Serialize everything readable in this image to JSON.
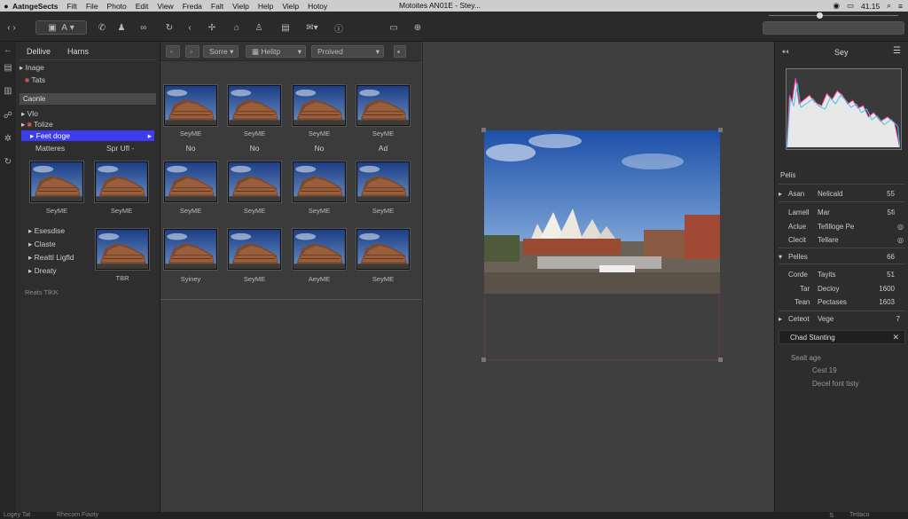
{
  "menubar": {
    "app": "AatngeSects",
    "items": [
      "Filt",
      "File",
      "Photo",
      "Edit",
      "View",
      "Freda",
      "Falt",
      "Vielp",
      "Help",
      "Vielp",
      "Hotoy"
    ],
    "title": "Motoites AN01E - Stey...",
    "time": "41.15"
  },
  "toolbar": {
    "zoom_label": "A"
  },
  "left_panel": {
    "tabs": [
      "Dellive",
      "Harns"
    ],
    "items_top": [
      "Inage",
      "Tats"
    ],
    "header": "Caonle",
    "items_mid": [
      "Vlo",
      "Tolize"
    ],
    "selected": "Feet doge",
    "row_labels": [
      "Matteres",
      "Spr Ufl -"
    ],
    "items_bottom": [
      "Esesdise",
      "Claste",
      "Reattl Ligfld",
      "Dreaty"
    ],
    "bottom_thumb_label": "TBR",
    "footer": "Reats TlKK"
  },
  "grid_panel": {
    "buttons": [
      "Sorre",
      "Helitp",
      "Proived"
    ],
    "row1_labels": [
      "SeyME",
      "SeyME",
      "SeyME",
      "SeyME"
    ],
    "row1_sub": [
      "No",
      "No",
      "No",
      "Ad"
    ],
    "row2_labels": [
      "SeyME",
      "SeyME",
      "SeyME",
      "SeyME"
    ],
    "row3_labels": [
      "Syiney",
      "SeyME",
      "AeyME",
      "SeyME"
    ],
    "left_thumbs_labels": [
      "SeyME",
      "SeyME"
    ]
  },
  "right_panel": {
    "title": "Sey",
    "section": "Pelis",
    "rows": [
      {
        "arrow": "▸",
        "label": "Asan",
        "value": "Nelicald",
        "num": "55"
      },
      {
        "arrow": "",
        "label": "Lamell",
        "value": "Mar",
        "num": "5fi"
      },
      {
        "arrow": "",
        "label": "Aclue",
        "value": "Tefilloge Pe",
        "num": ""
      },
      {
        "arrow": "",
        "label": "Clecit",
        "value": "Tellare",
        "num": ""
      },
      {
        "arrow": "▾",
        "label": "Pelles",
        "value": "",
        "num": "66"
      },
      {
        "arrow": "",
        "label": "Corde",
        "value": "Tayits",
        "num": "51"
      },
      {
        "arrow": "",
        "label": "Tar",
        "value": "Decloy",
        "num": "1600"
      },
      {
        "arrow": "",
        "label": "Tean",
        "value": "Pectases",
        "num": "1603"
      },
      {
        "arrow": "▸",
        "label": "Ceteot",
        "value": "Vege",
        "num": "7"
      }
    ],
    "chip": "Chad Stanting",
    "notes": [
      "Sealt age",
      "Cest 19",
      "Decel font tisty"
    ],
    "footer": "Tettaco"
  },
  "status": {
    "left": "Logey  Tat",
    "mid": "Rhecom Fiaoty"
  }
}
